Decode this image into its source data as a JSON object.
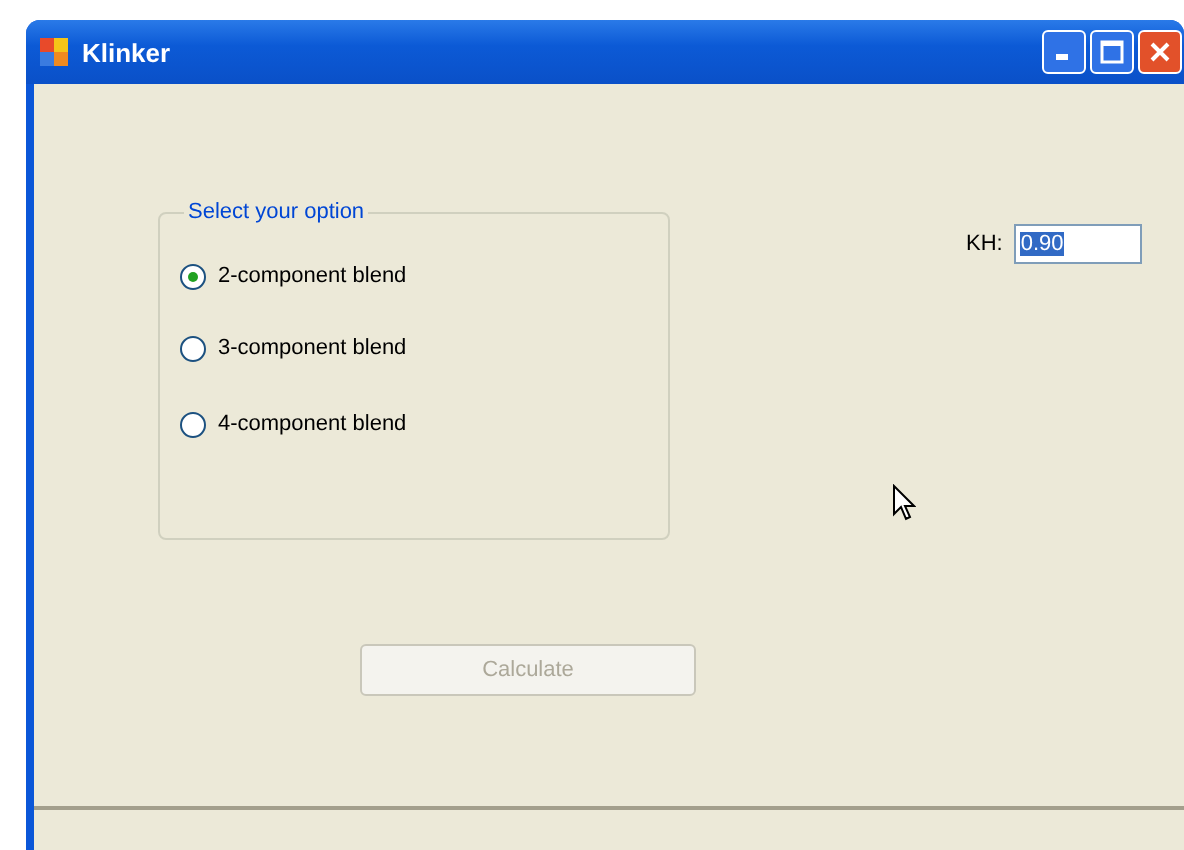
{
  "window": {
    "title": "Klinker"
  },
  "option_group": {
    "title": "Select your option",
    "options": [
      {
        "label": "2-component blend",
        "selected": true
      },
      {
        "label": "3-component blend",
        "selected": false
      },
      {
        "label": "4-component blend",
        "selected": false
      }
    ]
  },
  "kh_field": {
    "label": "KH:",
    "value": "0.90",
    "text_selected": true
  },
  "calculate_button": {
    "label": "Calculate",
    "disabled": true
  }
}
